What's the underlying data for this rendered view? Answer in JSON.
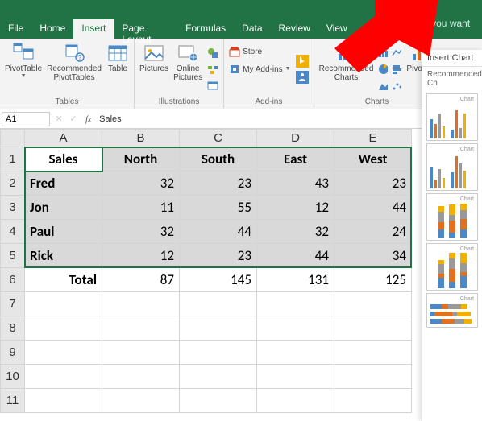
{
  "tabs": {
    "file": "File",
    "home": "Home",
    "insert": "Insert",
    "pageLayout": "Page Layout",
    "formulas": "Formulas",
    "data": "Data",
    "review": "Review",
    "view": "View",
    "tell": "Tell me what you want to d"
  },
  "ribbon": {
    "pivotTable": "PivotTable",
    "recommendedPivot": "Recommended\nPivotTables",
    "table": "Table",
    "tablesGroup": "Tables",
    "pictures": "Pictures",
    "onlinePictures": "Online\nPictures",
    "illustrationsGroup": "Illustrations",
    "store": "Store",
    "myAddins": "My Add-ins",
    "addinsGroup": "Add-ins",
    "recommendedCharts": "Recommended\nCharts",
    "chartsGroup": "Charts",
    "pivotChart": "PivotCh"
  },
  "namebox": "A1",
  "formula": "Sales",
  "colHdrs": [
    "A",
    "B",
    "C",
    "D",
    "E"
  ],
  "rowHdrs": [
    "1",
    "2",
    "3",
    "4",
    "5",
    "6",
    "7",
    "8",
    "9",
    "10",
    "11"
  ],
  "cells": {
    "A1": "Sales",
    "B1": "North",
    "C1": "South",
    "D1": "East",
    "E1": "West",
    "A2": "Fred",
    "B2": "32",
    "C2": "23",
    "D2": "43",
    "E2": "23",
    "A3": "Jon",
    "B3": "11",
    "C3": "55",
    "D3": "12",
    "E3": "44",
    "A4": "Paul",
    "B4": "32",
    "C4": "44",
    "D4": "32",
    "E4": "24",
    "A5": "Rick",
    "B5": "12",
    "C5": "23",
    "D5": "44",
    "E5": "34",
    "A6": "Total",
    "B6": "87",
    "C6": "145",
    "D6": "131",
    "E6": "125"
  },
  "sidePanel": {
    "title": "Insert Chart",
    "subtitle": "Recommended Ch",
    "thumbLabel": "Chart"
  }
}
